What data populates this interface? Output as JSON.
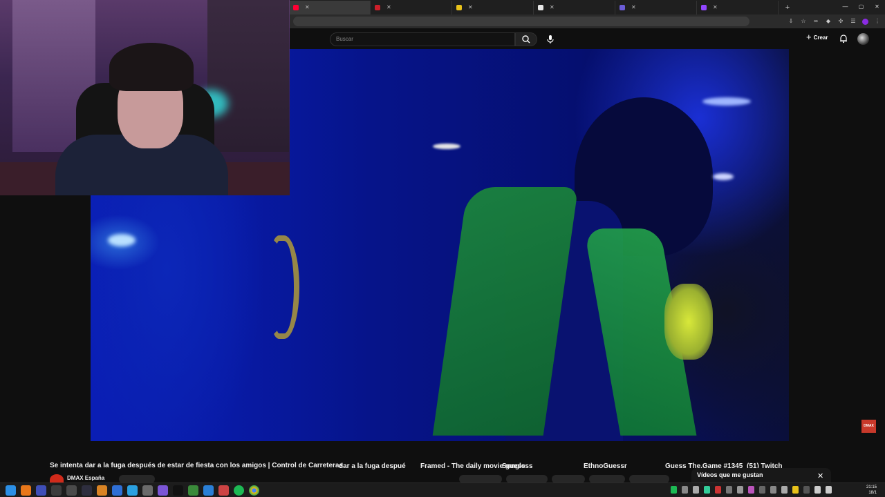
{
  "browser": {
    "tabs": [
      {
        "title": "dar a la fuga despué",
        "color": "#ff0033",
        "active": true
      },
      {
        "title": "Framed - The daily movie guess",
        "color": "#cc1f2a",
        "active": false
      },
      {
        "title": "Songless",
        "color": "#e8c21a",
        "active": false
      },
      {
        "title": "EthnoGuessr",
        "color": "#e8e8e8",
        "active": false
      },
      {
        "title": "Guess The.Game #1345",
        "color": "#6b5cd6",
        "active": false
      },
      {
        "title": "(51) Twitch",
        "color": "#9146ff",
        "active": false
      }
    ],
    "new_tab_symbol": "+"
  },
  "youtube": {
    "search_placeholder": "Buscar",
    "create_label": "Crear",
    "video_title": "Se intenta dar a la fuga después de estar de fiesta con los amigos | Control de Carreteras",
    "channel_name": "DMAX España",
    "watermark": "DMAX",
    "liked_panel_title": "Vídeos que me gustan"
  },
  "taskbar": {
    "time": "21:15",
    "date": "18/1",
    "icons": [
      "windows-start-icon",
      "search-icon",
      "app-icon",
      "app-icon",
      "app-icon",
      "app-icon",
      "app-icon",
      "app-icon",
      "app-icon",
      "app-icon",
      "app-icon",
      "app-icon",
      "app-icon",
      "app-icon",
      "spotify-icon",
      "chrome-icon"
    ]
  },
  "colors": {
    "youtube_red": "#ff0033",
    "background": "#0f0f0f",
    "video_blue": "#0a1eb5"
  }
}
